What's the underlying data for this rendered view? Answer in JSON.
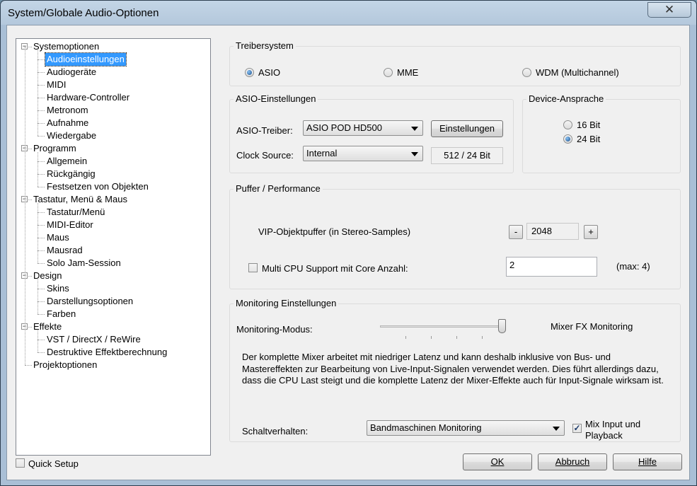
{
  "window": {
    "title": "System/Globale Audio-Optionen",
    "close_glyph": "✕"
  },
  "tree": {
    "items": [
      {
        "label": "Systemoptionen",
        "level": 0,
        "toggle": "−"
      },
      {
        "label": "Audioeinstellungen",
        "level": 1,
        "selected": true
      },
      {
        "label": "Audiogeräte",
        "level": 1
      },
      {
        "label": "MIDI",
        "level": 1
      },
      {
        "label": "Hardware-Controller",
        "level": 1
      },
      {
        "label": "Metronom",
        "level": 1
      },
      {
        "label": "Aufnahme",
        "level": 1
      },
      {
        "label": "Wiedergabe",
        "level": 1
      },
      {
        "label": "Programm",
        "level": 0,
        "toggle": "−"
      },
      {
        "label": "Allgemein",
        "level": 1
      },
      {
        "label": "Rückgängig",
        "level": 1
      },
      {
        "label": "Festsetzen von Objekten",
        "level": 1
      },
      {
        "label": "Tastatur, Menü & Maus",
        "level": 0,
        "toggle": "−"
      },
      {
        "label": "Tastatur/Menü",
        "level": 1
      },
      {
        "label": "MIDI-Editor",
        "level": 1
      },
      {
        "label": "Maus",
        "level": 1
      },
      {
        "label": "Mausrad",
        "level": 1
      },
      {
        "label": "Solo Jam-Session",
        "level": 1
      },
      {
        "label": "Design",
        "level": 0,
        "toggle": "−"
      },
      {
        "label": "Skins",
        "level": 1
      },
      {
        "label": "Darstellungsoptionen",
        "level": 1
      },
      {
        "label": "Farben",
        "level": 1
      },
      {
        "label": "Effekte",
        "level": 0,
        "toggle": "−"
      },
      {
        "label": "VST / DirectX / ReWire",
        "level": 1
      },
      {
        "label": "Destruktive Effektberechnung",
        "level": 1
      },
      {
        "label": "Projektoptionen",
        "level": 0
      }
    ]
  },
  "quick_setup": {
    "label": "Quick Setup",
    "checked": false
  },
  "treiber": {
    "title": "Treibersystem",
    "asio": "ASIO",
    "mme": "MME",
    "wdm": "WDM (Multichannel)",
    "selected": "ASIO"
  },
  "asio": {
    "title": "ASIO-Einstellungen",
    "driver_label": "ASIO-Treiber:",
    "driver_value": "ASIO POD HD500",
    "settings_button": "Einstellungen",
    "clock_label": "Clock Source:",
    "clock_value": "Internal",
    "format": "512 / 24 Bit"
  },
  "device": {
    "title": "Device-Ansprache",
    "bit16": "16 Bit",
    "bit24": "24 Bit",
    "selected": "24 Bit"
  },
  "buffer": {
    "title": "Puffer / Performance",
    "vip_label": "VIP-Objektpuffer (in Stereo-Samples)",
    "minus": "-",
    "vip_value": "2048",
    "plus": "+",
    "multicpu_label": "Multi CPU Support mit Core Anzahl:",
    "multicpu_checked": false,
    "core_value": "2",
    "max_label": "(max: 4)"
  },
  "monitoring": {
    "title": "Monitoring Einstellungen",
    "mode_label": "Monitoring-Modus:",
    "mode_value": "Mixer FX Monitoring",
    "slider_level": 1.0,
    "description": "Der komplette Mixer arbeitet mit niedriger Latenz und kann deshalb inklusive von Bus- und Mastereffekten zur Bearbeitung von Live-Input-Signalen verwendet werden. Dies führt allerdings dazu, dass die CPU Last steigt und die komplette Latenz der Mixer-Effekte auch für Input-Signale wirksam ist.",
    "switch_label": "Schaltverhalten:",
    "switch_value": "Bandmaschinen Monitoring",
    "mix_input_label": "Mix Input und Playback",
    "mix_input_checked": true
  },
  "buttons": {
    "ok": "OK",
    "cancel": "Abbruch",
    "help": "Hilfe"
  }
}
